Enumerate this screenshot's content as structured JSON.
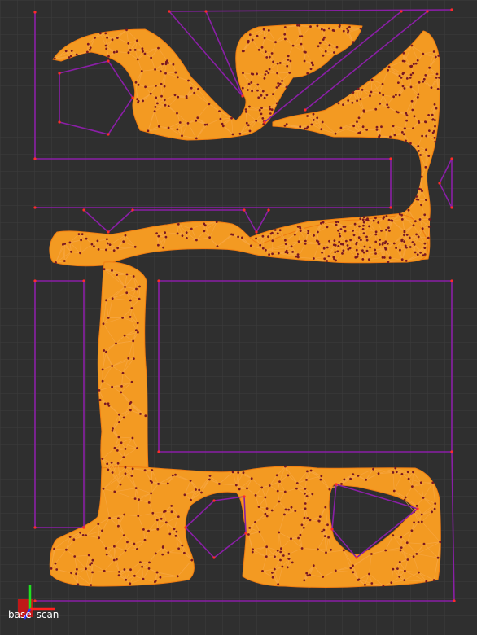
{
  "viewport": {
    "background": "#2f2f2f",
    "grid_color": "#3c3c3c"
  },
  "colors": {
    "walls": "#8a1fa6",
    "wall_vertices": "#ff2a2a",
    "navmesh_fill": "#f39a22",
    "navmesh_edges": "#f07d12",
    "sample_points": "#7a1820"
  },
  "axes": {
    "x_color": "#ff2020",
    "y_color": "#20e020",
    "z_color": "#3030ff",
    "base_color": "#c01818",
    "frame_label": "base_scan"
  },
  "icons": {
    "frame_axes": "tf-axes-icon"
  }
}
